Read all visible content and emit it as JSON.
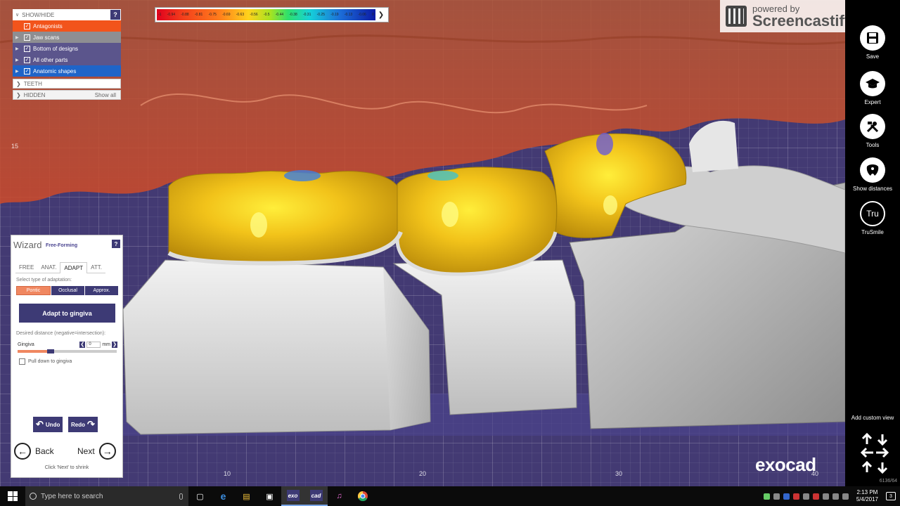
{
  "show_hide": {
    "title": "SHOW/HIDE",
    "help": "?",
    "items": [
      {
        "label": "Antagonists",
        "checked": true,
        "color": "#f2541b"
      },
      {
        "label": "Jaw scans",
        "checked": true,
        "color": "#8e8e92"
      },
      {
        "label": "Bottom of designs",
        "checked": true,
        "color": "#5b558c"
      },
      {
        "label": "All other parts",
        "checked": true,
        "color": "#5b558c"
      },
      {
        "label": "Anatomic shapes",
        "checked": true,
        "color": "#1f64c8"
      }
    ],
    "teeth_label": "TEETH",
    "hidden_label": "HIDDEN",
    "show_all": "Show all"
  },
  "color_scale": {
    "ticks": [
      "-1",
      "-0.94",
      "-0.88",
      "-0.81",
      "-0.75",
      "-0.69",
      "-0.63",
      "-0.56",
      "-0.5",
      "-0.44",
      "-0.38",
      "-0.31",
      "-0.25",
      "-0.19",
      "-0.13",
      "-0.06",
      "0"
    ]
  },
  "axis": {
    "left_label": "15",
    "bottom_labels": [
      "10",
      "20",
      "30",
      "40"
    ]
  },
  "watermark": {
    "small": "powered by",
    "big": "Screencastify Lite"
  },
  "toolbar": {
    "items": [
      {
        "label": "Save",
        "icon": "save-icon"
      },
      {
        "label": "Expert",
        "icon": "graduation-cap-icon"
      },
      {
        "label": "Tools",
        "icon": "tools-icon"
      },
      {
        "label": "Show distances",
        "icon": "tooth-distance-icon"
      },
      {
        "label": "TruSmile",
        "icon": "trusmile-icon",
        "glyph": "Tru"
      }
    ],
    "custom_view": "Add custom view",
    "coords": "6136/64"
  },
  "wizard": {
    "title": "Wizard",
    "subtitle": "Free-Forming",
    "help": "?",
    "tabs": [
      "FREE",
      "ANAT.",
      "ADAPT",
      "ATT."
    ],
    "active_tab": "ADAPT",
    "select_label": "Select type of adaptation:",
    "segments": [
      "Pontic",
      "Occlusal",
      "Approx."
    ],
    "active_segment": "Pontic",
    "adapt_button": "Adapt to gingiva",
    "distance_label": "Desired distance (negative=intersection):",
    "gingiva_label": "Gingiva",
    "gingiva_value": "0",
    "gingiva_unit": "mm",
    "slider_value": 0.3,
    "pull_down": "Pull down to gingiva",
    "undo": "Undo",
    "redo": "Redo",
    "back": "Back",
    "next": "Next",
    "hint": "Click 'Next' to shrink"
  },
  "brand": "exocad",
  "taskbar": {
    "search_placeholder": "Type here to search",
    "apps": [
      "task-view",
      "edge",
      "file-explorer",
      "store",
      "exo",
      "cad",
      "itunes",
      "chrome"
    ],
    "exo_label": "exo",
    "cad_label": "cad",
    "time": "2:13 PM",
    "date": "5/4/2017",
    "notifications": "3"
  }
}
